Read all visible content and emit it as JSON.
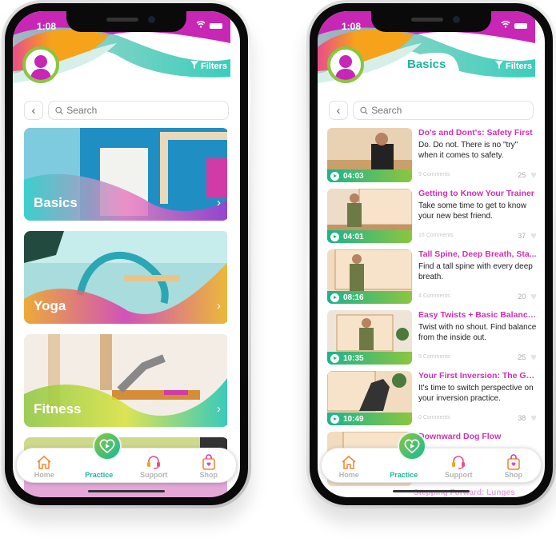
{
  "status": {
    "time": "1:08"
  },
  "left_phone": {
    "filters_label": "Filters",
    "search": {
      "placeholder": "Search"
    },
    "categories": [
      {
        "label": "Basics"
      },
      {
        "label": "Yoga"
      },
      {
        "label": "Fitness"
      }
    ]
  },
  "right_phone": {
    "title": "Basics",
    "filters_label": "Filters",
    "search": {
      "placeholder": "Search"
    },
    "videos": [
      {
        "title": "Do's and Dont's: Safety First",
        "desc": "Do. Do not. There is no \"try\" when it comes to safety.",
        "duration": "04:03",
        "comments": "9 Comments",
        "likes": "25"
      },
      {
        "title": "Getting to Know Your Trainer",
        "desc": "Take some time to get to know your new best friend.",
        "duration": "04:01",
        "comments": "16 Comments",
        "likes": "37"
      },
      {
        "title": "Tall Spine, Deep Breath, Sta...",
        "desc": "Find a tall spine with every deep breath.",
        "duration": "08:16",
        "comments": "4 Comments",
        "likes": "20"
      },
      {
        "title": "Easy Twists + Basic Balances",
        "desc": "Twist with no shout. Find balance from the inside out.",
        "duration": "10:35",
        "comments": "5 Comments",
        "likes": "25"
      },
      {
        "title": "Your First Inversion: The Ga...",
        "desc": "It's time to switch perspective on your inversion practice.",
        "duration": "10:49",
        "comments": "0 Comments",
        "likes": "38"
      },
      {
        "title": "Downward Dog Flow",
        "desc": "",
        "duration": "",
        "comments": "",
        "likes": ""
      }
    ],
    "partial_next_title": "Stepping Forward: Lunges"
  },
  "tabbar": {
    "tabs": [
      {
        "label": "Home",
        "icon": "home-icon"
      },
      {
        "label": "Practice",
        "icon": "heart-play-icon",
        "active": true
      },
      {
        "label": "Support",
        "icon": "headset-icon"
      },
      {
        "label": "Shop",
        "icon": "shopping-bag-icon"
      }
    ]
  },
  "colors": {
    "magenta": "#c727b4",
    "teal": "#1ab89a",
    "orange": "#f7a21b",
    "green": "#8cc63f"
  }
}
